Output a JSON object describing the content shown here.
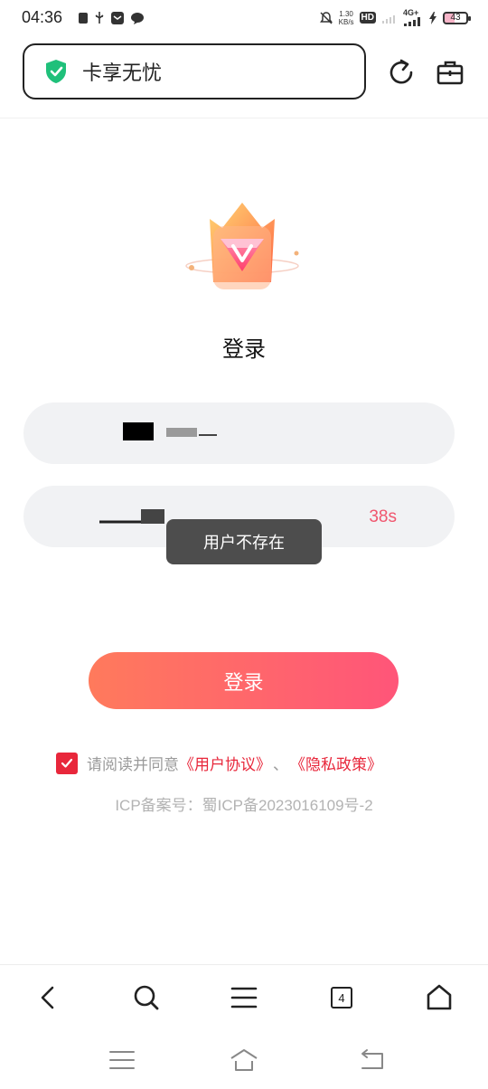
{
  "status_bar": {
    "time": "04:36",
    "net_speed_value": "1.30",
    "net_speed_unit": "KB/s",
    "hd_label": "HD",
    "network_label": "4G+",
    "battery_level": "43"
  },
  "browser": {
    "address_title": "卡享无忧"
  },
  "login": {
    "heading": "登录",
    "countdown": "38s",
    "submit_label": "登录"
  },
  "toast": {
    "message": "用户不存在"
  },
  "agreement": {
    "prefix": "请阅读并同意",
    "user_agreement": "《用户协议》",
    "separator": "、",
    "privacy_policy": "《隐私政策》",
    "checked": true
  },
  "footer": {
    "icp": "ICP备案号：蜀ICP备2023016109号-2"
  },
  "bottom_nav": {
    "tab_count": "4"
  },
  "colors": {
    "accent": "#e8273b",
    "button_start": "#ff7a5c",
    "button_end": "#ff5579",
    "countdown": "#f0566e"
  }
}
